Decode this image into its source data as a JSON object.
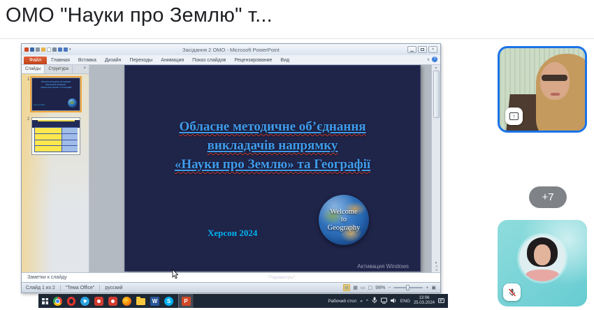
{
  "header": {
    "title": "ОМО \"Науки про Землю\" т..."
  },
  "ppt": {
    "window_title": "Засідання 2 ОМО - Microsoft PowerPoint",
    "ribbon_tabs": [
      "Файл",
      "Главная",
      "Вставка",
      "Дизайн",
      "Переходы",
      "Анимация",
      "Показ слайдов",
      "Рецензирование",
      "Вид"
    ],
    "pane_tabs": [
      "Слайды",
      "Структура"
    ],
    "thumb_numbers": [
      "1",
      "2"
    ],
    "slide": {
      "title_line1": "Обласне методичне об’єднання",
      "title_line2": "викладачів напрямку",
      "title_line3": "«Науки про Землю» та Географії",
      "location": "Херсон 2024",
      "globe_lines": [
        "Welcome",
        "to",
        "Geography"
      ],
      "watermark": "Активация Windows"
    },
    "notes_label": "Заметки к слайду",
    "notes_ghost": "\"Параметры\".",
    "status": {
      "slide_indicator": "Слайд 1 из 2",
      "theme": "\"Тема Office\"",
      "language": "русский",
      "zoom_level": "98%"
    }
  },
  "taskbar": {
    "letters": {
      "word": "W",
      "skype": "S",
      "powerpoint": "P"
    },
    "tray": {
      "toolbar": "Рабочий стол",
      "language": "ENG",
      "time": "13:06",
      "date": "25.03.2024"
    }
  },
  "meet": {
    "overflow_badge": "+7"
  },
  "icons": {
    "close_x": "×",
    "help": "?",
    "collapse": "∨",
    "qat_dropdown": "▾",
    "caret_up": "^",
    "chevron_right": "»",
    "up_arrow": "↑",
    "scroll_up": "▲",
    "scroll_down": "▼",
    "prev_double": "«",
    "next_double": "»",
    "view_normal": "▤",
    "view_sorter": "▦",
    "view_reading": "▭",
    "view_show": "▢",
    "minus": "−",
    "plus": "+",
    "fit": "▣"
  },
  "colors": {
    "accent_blue": "#1a73e8",
    "slide_bg": "#1f2449",
    "title_blue": "#3f9ceb",
    "cyan": "#00b0f0",
    "taskbar": "#1d2836",
    "file_tab_orange": "#c74f20"
  }
}
